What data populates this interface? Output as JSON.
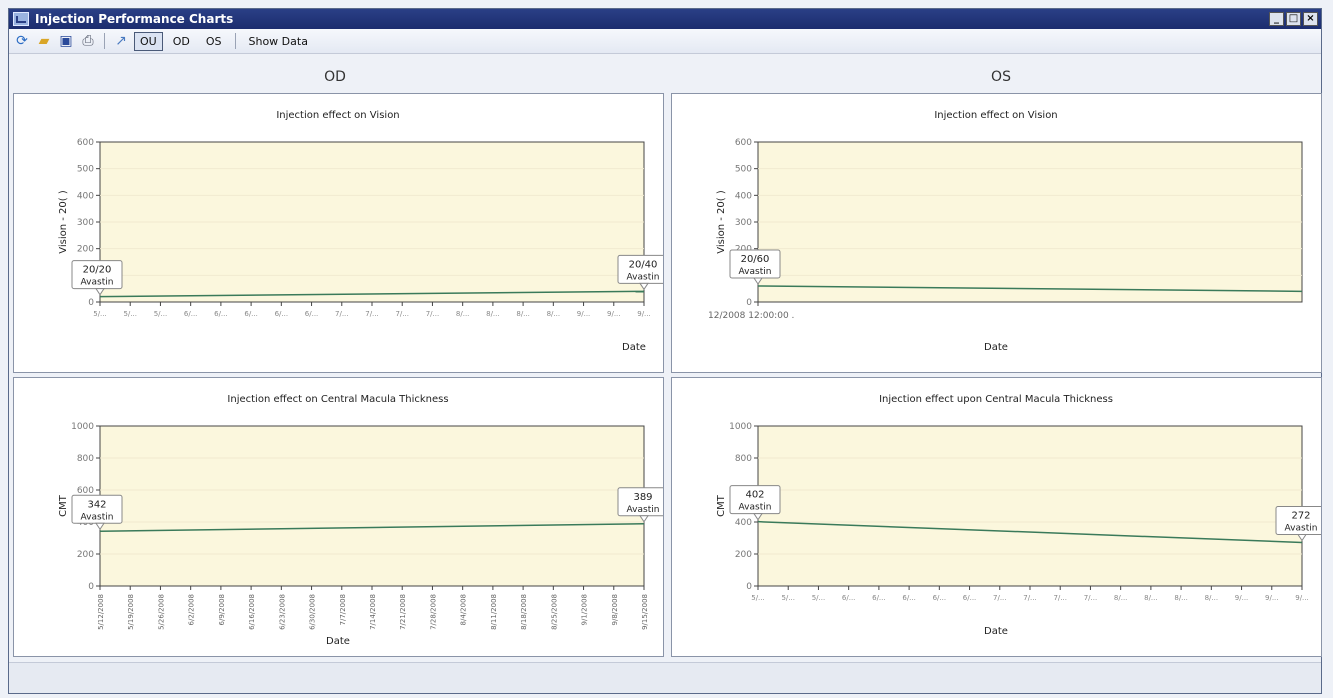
{
  "window": {
    "title": "Injection Performance Charts"
  },
  "toolbar": {
    "icons": [
      "refresh-icon",
      "open-folder-icon",
      "save-icon",
      "print-icon",
      "export-icon"
    ],
    "ou_label": "OU",
    "od_label": "OD",
    "os_label": "OS",
    "show_data_label": "Show Data"
  },
  "headers": {
    "od": "OD",
    "os": "OS"
  },
  "colors": {
    "plot_bg": "#fbf7dd",
    "line": "#3a7a5a",
    "axis": "#444444",
    "grid": "#f0ead0"
  },
  "chart_data": [
    {
      "type": "line",
      "title": "Injection effect on Vision",
      "ylabel": "Vision - 20( )",
      "xlabel": "Date",
      "ylim": [
        0,
        600
      ],
      "yticks": [
        "600",
        "500",
        "400",
        "300",
        "200",
        "100",
        "0"
      ],
      "xtick_labels": [
        "5/...",
        "5/...",
        "5/...",
        "6/...",
        "6/...",
        "6/...",
        "6/...",
        "6/...",
        "7/...",
        "7/...",
        "7/...",
        "7/...",
        "8/...",
        "8/...",
        "8/...",
        "8/...",
        "9/...",
        "9/...",
        "9/..."
      ],
      "series": [
        {
          "values": [
            20,
            40
          ]
        }
      ],
      "annotations": [
        {
          "line1": "20/20",
          "line2": "Avastin"
        },
        {
          "line1": "20/40",
          "line2": "Avastin"
        }
      ]
    },
    {
      "type": "line",
      "title": "Injection effect on Vision",
      "ylabel": "Vision - 20( )",
      "xlabel": "Date",
      "ylim": [
        0,
        600
      ],
      "yticks": [
        "600",
        "500",
        "400",
        "300",
        "200",
        "100",
        "0"
      ],
      "xtick_labels": [
        "12/2008 12:00:00 ."
      ],
      "series": [
        {
          "values": [
            60,
            40
          ]
        }
      ],
      "annotations": [
        {
          "line1": "20/60",
          "line2": "Avastin"
        }
      ]
    },
    {
      "type": "line",
      "title": "Injection effect on Central Macula Thickness",
      "ylabel": "CMT",
      "xlabel": "Date",
      "ylim": [
        0,
        1000
      ],
      "yticks": [
        "1000",
        "800",
        "600",
        "400",
        "200",
        "0"
      ],
      "xtick_labels": [
        "5/12/2008",
        "5/19/2008",
        "5/26/2008",
        "6/2/2008",
        "6/9/2008",
        "6/16/2008",
        "6/23/2008",
        "6/30/2008",
        "7/7/2008",
        "7/14/2008",
        "7/21/2008",
        "7/28/2008",
        "8/4/2008",
        "8/11/2008",
        "8/18/2008",
        "8/25/2008",
        "9/1/2008",
        "9/8/2008",
        "9/15/2008"
      ],
      "series": [
        {
          "values": [
            342,
            389
          ]
        }
      ],
      "annotations": [
        {
          "line1": "342",
          "line2": "Avastin"
        },
        {
          "line1": "389",
          "line2": "Avastin"
        }
      ]
    },
    {
      "type": "line",
      "title": "Injection effect upon Central Macula Thickness",
      "ylabel": "CMT",
      "xlabel": "Date",
      "ylim": [
        0,
        1000
      ],
      "yticks": [
        "1000",
        "800",
        "600",
        "400",
        "200",
        "0"
      ],
      "xtick_labels": [
        "5/...",
        "5/...",
        "5/...",
        "6/...",
        "6/...",
        "6/...",
        "6/...",
        "6/...",
        "7/...",
        "7/...",
        "7/...",
        "7/...",
        "8/...",
        "8/...",
        "8/...",
        "8/...",
        "9/...",
        "9/...",
        "9/..."
      ],
      "series": [
        {
          "values": [
            402,
            272
          ]
        }
      ],
      "annotations": [
        {
          "line1": "402",
          "line2": "Avastin"
        },
        {
          "line1": "272",
          "line2": "Avastin"
        }
      ]
    }
  ]
}
